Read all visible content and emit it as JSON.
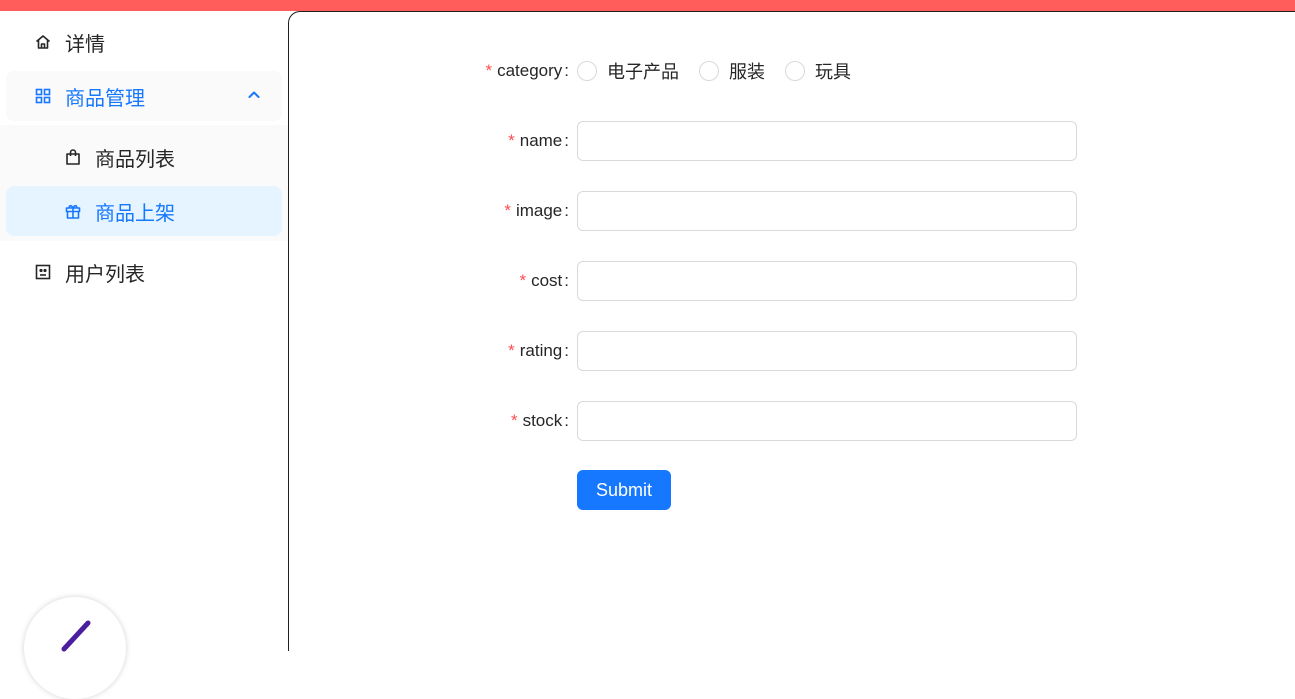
{
  "colors": {
    "accent": "#1677ff",
    "required": "#ff4d4f",
    "topbar": "#ff5c5c"
  },
  "sidebar": {
    "items": [
      {
        "label": "详情",
        "icon": "home-icon"
      },
      {
        "label": "商品管理",
        "icon": "grid-icon",
        "expanded": true
      },
      {
        "label": "商品列表",
        "icon": "shopping-bag-icon"
      },
      {
        "label": "商品上架",
        "icon": "gift-icon",
        "selected": true
      },
      {
        "label": "用户列表",
        "icon": "user-card-icon"
      }
    ]
  },
  "form": {
    "category": {
      "label": "category",
      "required": "*",
      "options": [
        "电子产品",
        "服装",
        "玩具"
      ],
      "selected": null
    },
    "name": {
      "label": "name",
      "required": "*",
      "value": ""
    },
    "image": {
      "label": "image",
      "required": "*",
      "value": ""
    },
    "cost": {
      "label": "cost",
      "required": "*",
      "value": ""
    },
    "rating": {
      "label": "rating",
      "required": "*",
      "value": ""
    },
    "stock": {
      "label": "stock",
      "required": "*",
      "value": ""
    },
    "colon": ":",
    "submit_label": "Submit"
  }
}
